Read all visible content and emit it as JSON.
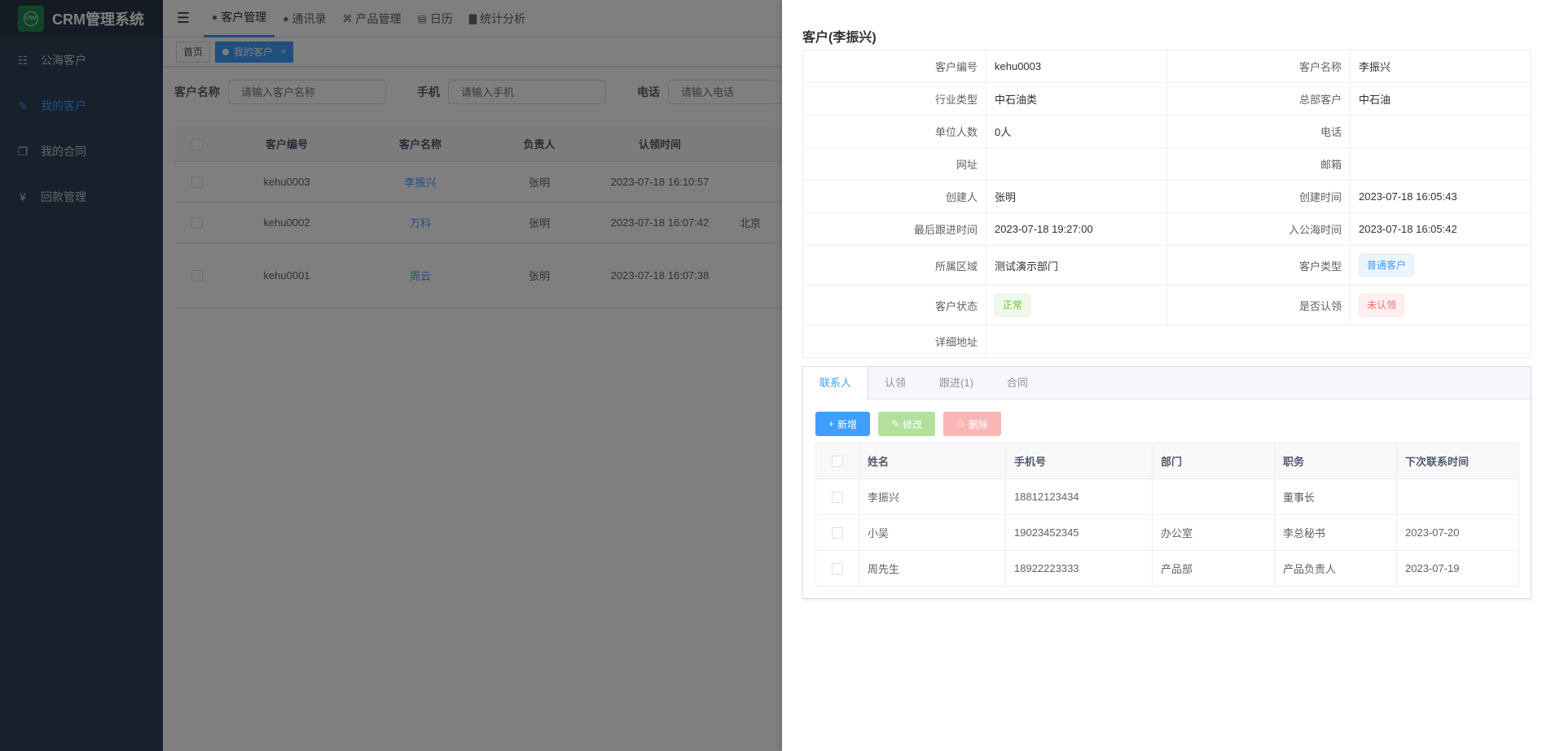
{
  "app": {
    "title": "CRM管理系统",
    "logo_text": "CRM"
  },
  "sidebar": {
    "items": [
      {
        "label": "公海客户",
        "icon": "sitemap-icon"
      },
      {
        "label": "我的客户",
        "icon": "edit-icon"
      },
      {
        "label": "我的合同",
        "icon": "documents-icon"
      },
      {
        "label": "回款管理",
        "icon": "yen-icon"
      }
    ]
  },
  "topnav": {
    "items": [
      {
        "label": "客户管理",
        "icon": "user-icon"
      },
      {
        "label": "通讯录",
        "icon": "user-icon"
      },
      {
        "label": "产品管理",
        "icon": "cart-icon"
      },
      {
        "label": "日历",
        "icon": "calendar-icon"
      },
      {
        "label": "统计分析",
        "icon": "bar-chart-icon"
      }
    ]
  },
  "tags": {
    "home": "首页",
    "current": "我的客户",
    "close": "×"
  },
  "search": {
    "name_label": "客户名称",
    "name_placeholder": "请输入客户名称",
    "mobile_label": "手机",
    "mobile_placeholder": "请输入手机",
    "phone_label": "电话",
    "phone_placeholder": "请输入电话"
  },
  "main_table": {
    "columns": [
      "客户编号",
      "客户名称",
      "负责人",
      "认领时间"
    ],
    "rows": [
      {
        "code": "kehu0003",
        "name": "李振兴",
        "owner": "张明",
        "time": "2023-07-18 16:10:57",
        "extra": ""
      },
      {
        "code": "kehu0002",
        "name": "万科",
        "owner": "张明",
        "time": "2023-07-18 16:07:42",
        "extra": "北京"
      },
      {
        "code": "kehu0001",
        "name": "周云",
        "owner": "张明",
        "time": "2023-07-18 16:07:38",
        "extra": ""
      }
    ]
  },
  "drawer": {
    "title": "客户(李振兴)",
    "fields": {
      "code_label": "客户编号",
      "code": "kehu0003",
      "name_label": "客户名称",
      "name": "李振兴",
      "industry_label": "行业类型",
      "industry": "中石油类",
      "hq_label": "总部客户",
      "hq": "中石油",
      "staff_label": "单位人数",
      "staff": "0人",
      "phone_label": "电话",
      "phone": "",
      "website_label": "网址",
      "website": "",
      "email_label": "邮箱",
      "email": "",
      "creator_label": "创建人",
      "creator": "张明",
      "created_label": "创建时间",
      "created": "2023-07-18 16:05:43",
      "last_follow_label": "最后跟进时间",
      "last_follow": "2023-07-18 19:27:00",
      "pool_time_label": "入公海时间",
      "pool_time": "2023-07-18 16:05:42",
      "region_label": "所属区域",
      "region": "测试演示部门",
      "type_label": "客户类型",
      "type": "普通客户",
      "status_label": "客户状态",
      "status": "正常",
      "claimed_label": "是否认领",
      "claimed": "未认领",
      "address_label": "详细地址",
      "address": ""
    },
    "tabs": [
      "联系人",
      "认领",
      "跟进(1)",
      "合同"
    ],
    "buttons": {
      "add": "新增",
      "edit": "修改",
      "delete": "删除"
    },
    "contacts": {
      "columns": [
        "姓名",
        "手机号",
        "部门",
        "职务",
        "下次联系时间"
      ],
      "rows": [
        {
          "name": "李振兴",
          "mobile": "18812123434",
          "dept": "",
          "title": "董事长",
          "next": ""
        },
        {
          "name": "小吴",
          "mobile": "19023452345",
          "dept": "办公室",
          "title": "李总秘书",
          "next": "2023-07-20"
        },
        {
          "name": "周先生",
          "mobile": "18922223333",
          "dept": "产品部",
          "title": "产品负责人",
          "next": "2023-07-19"
        }
      ]
    }
  },
  "colors": {
    "primary": "#409eff",
    "sidebar": "#304156",
    "success": "#67c23a",
    "danger": "#f56c6c"
  }
}
